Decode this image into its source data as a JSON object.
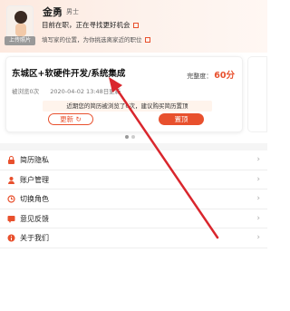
{
  "profile": {
    "upload_label": "上传照片",
    "name": "金勇",
    "gender": "男士",
    "status": "目前在职，正在寻找更好机会",
    "hint": "填写家的位置，为你挑选离家近的职位"
  },
  "resume_card": {
    "title": "东城区+软硬件开发/系统集成",
    "completeness_label": "完整度：",
    "completeness_value": "60分",
    "viewed": "被浏览0次",
    "date": "2020-04-02 13:48日更新",
    "tip": "近期您的简历被浏览了0次，建议购买简历置顶",
    "refresh_label": "更新",
    "top_label": "置顶"
  },
  "menu": [
    {
      "label": "简历隐私",
      "icon": "lock-icon"
    },
    {
      "label": "账户管理",
      "icon": "account-icon"
    },
    {
      "label": "切换角色",
      "icon": "switch-icon"
    },
    {
      "label": "意见反馈",
      "icon": "feedback-icon"
    },
    {
      "label": "关于我们",
      "icon": "info-icon"
    }
  ],
  "colors": {
    "accent": "#e8502d",
    "header_bg": "#fde9df",
    "arrow": "#d9262d"
  }
}
